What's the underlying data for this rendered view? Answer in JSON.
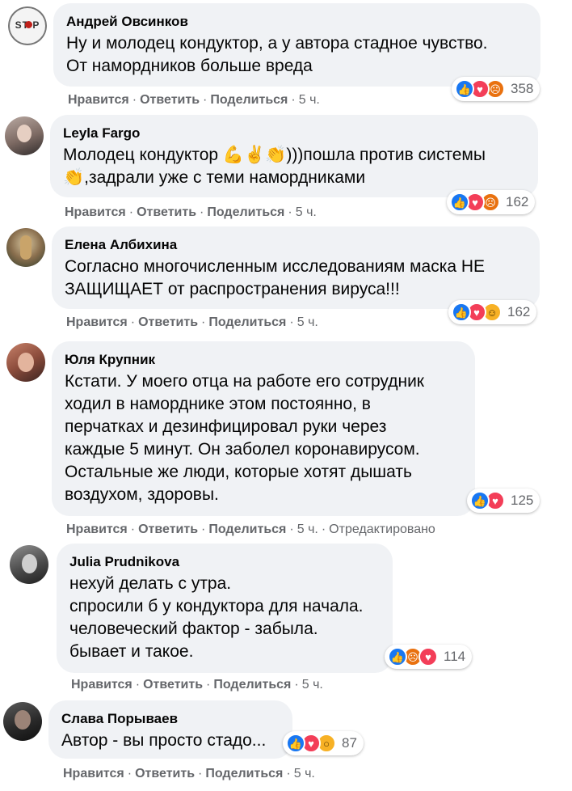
{
  "actions_labels": {
    "like": "Нравится",
    "reply": "Ответить",
    "share": "Поделиться",
    "sep": "·"
  },
  "comments": [
    {
      "author": "Андрей Овсинков",
      "lines": [
        "Ну и молодец кондуктор, а у автора стадное чувство.",
        "От намордников больше вреда"
      ],
      "reactions": [
        "like-icon",
        "love-icon",
        "angry-icon"
      ],
      "reaction_count": "358",
      "time": "5 ч.",
      "edited": "",
      "avatar_text": "ST P"
    },
    {
      "author": "Leyla Fargo",
      "lines": [
        "Молодец кондуктор 💪✌👏)))пошла против системы",
        "👏,задрали уже с теми намордниками"
      ],
      "reactions": [
        "like-icon",
        "love-icon",
        "angry-icon"
      ],
      "reaction_count": "162",
      "time": "5 ч.",
      "edited": ""
    },
    {
      "author": "Елена Албихина",
      "lines": [
        "Согласно многочисленным исследованиям маска НЕ",
        "ЗАЩИЩАЕТ от распространения вируса!!!"
      ],
      "reactions": [
        "like-icon",
        "love-icon",
        "haha-icon"
      ],
      "reaction_count": "162",
      "time": "5 ч.",
      "edited": ""
    },
    {
      "author": "Юля Крупник",
      "lines": [
        "Кстати. У моего отца на работе его сотрудник",
        "ходил в наморднике этом постоянно, в",
        "перчатках и дезинфицировал руки через",
        "каждые 5 минут. Он заболел коронавирусом.",
        "Остальные же люди, которые хотят дышать",
        "воздухом, здоровы."
      ],
      "reactions": [
        "like-icon",
        "love-icon"
      ],
      "reaction_count": "125",
      "time": "5 ч.",
      "edited": "Отредактировано"
    },
    {
      "author": "Julia Prudnikova",
      "lines": [
        "нехуй делать с утра.",
        "спросили б у кондуктора для начала.",
        "человеческий фактор - забыла.",
        "бывает и такое."
      ],
      "reactions": [
        "like-icon",
        "angry-icon",
        "love-icon"
      ],
      "reaction_count": "114",
      "time": "5 ч.",
      "edited": ""
    },
    {
      "author": "Слава Порываев",
      "lines": [
        "Автор - вы просто стадо..."
      ],
      "reactions": [
        "like-icon",
        "love-icon",
        "wow-icon"
      ],
      "reaction_count": "87",
      "time": "5 ч.",
      "edited": ""
    }
  ],
  "colors": {
    "bubble": "#f0f2f5",
    "secondary_text": "#65676b",
    "like": "#1877f2",
    "love": "#f33e58",
    "angry": "#e9710f",
    "haha_wow": "#f7b125"
  }
}
